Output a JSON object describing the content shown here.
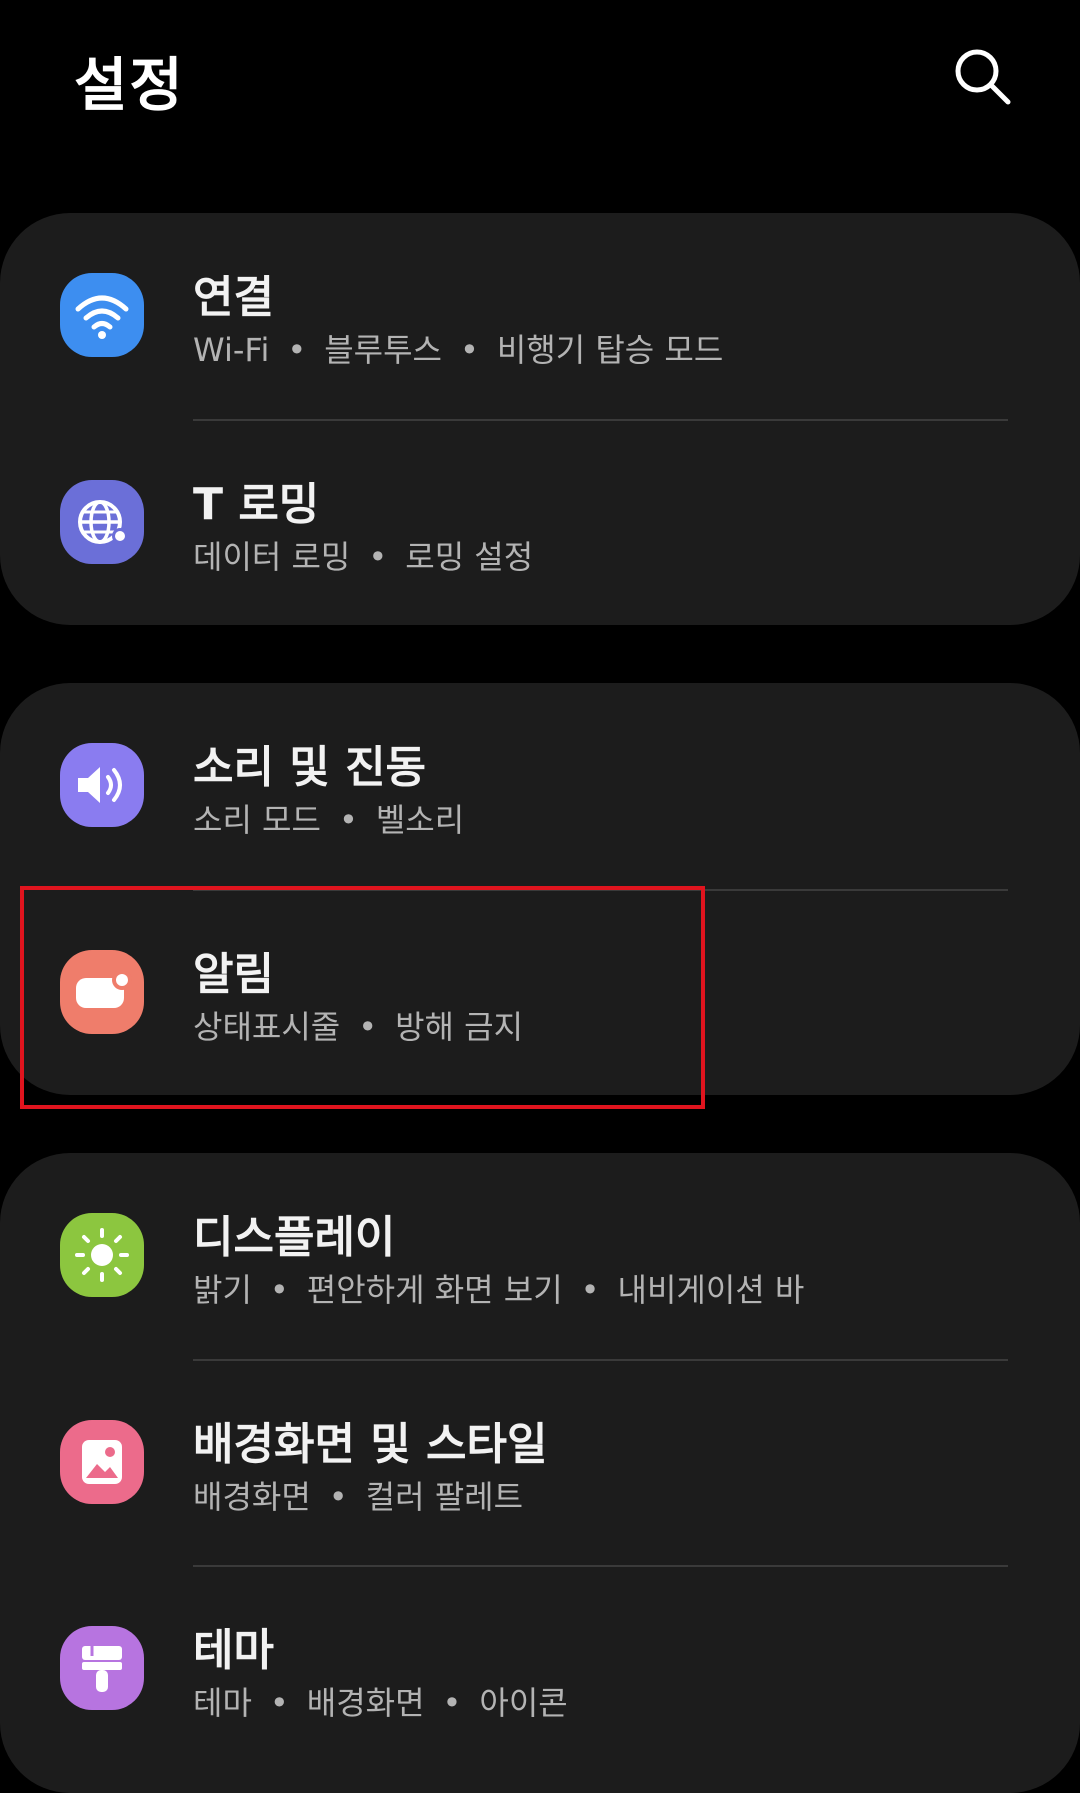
{
  "header": {
    "title": "설정",
    "search_icon": "search-icon"
  },
  "groups": [
    {
      "items": [
        {
          "title": "연결",
          "subtitle": [
            "Wi-Fi",
            "블루투스",
            "비행기 탑승 모드"
          ],
          "icon": "wifi-icon",
          "color": "#3d8ef0"
        },
        {
          "title": "T 로밍",
          "subtitle": [
            "데이터 로밍",
            "로밍 설정"
          ],
          "icon": "globe-icon",
          "color": "#6b6fd8"
        }
      ]
    },
    {
      "items": [
        {
          "title": "소리 및 진동",
          "subtitle": [
            "소리 모드",
            "벨소리"
          ],
          "icon": "speaker-icon",
          "color": "#8a7cf0"
        },
        {
          "title": "알림",
          "subtitle": [
            "상태표시줄",
            "방해 금지"
          ],
          "icon": "notification-icon",
          "color": "#ef7d6b"
        }
      ]
    },
    {
      "items": [
        {
          "title": "디스플레이",
          "subtitle": [
            "밝기",
            "편안하게 화면 보기",
            "내비게이션 바"
          ],
          "icon": "sun-icon",
          "color": "#8cc63f"
        },
        {
          "title": "배경화면 및 스타일",
          "subtitle": [
            "배경화면",
            "컬러 팔레트"
          ],
          "icon": "image-icon",
          "color": "#ec6b8b"
        },
        {
          "title": "테마",
          "subtitle": [
            "테마",
            "배경화면",
            "아이콘"
          ],
          "icon": "paintbrush-icon",
          "color": "#b774e0"
        }
      ]
    }
  ],
  "separator": "•",
  "highlight": {
    "target": "알림",
    "color": "#e0141e"
  }
}
